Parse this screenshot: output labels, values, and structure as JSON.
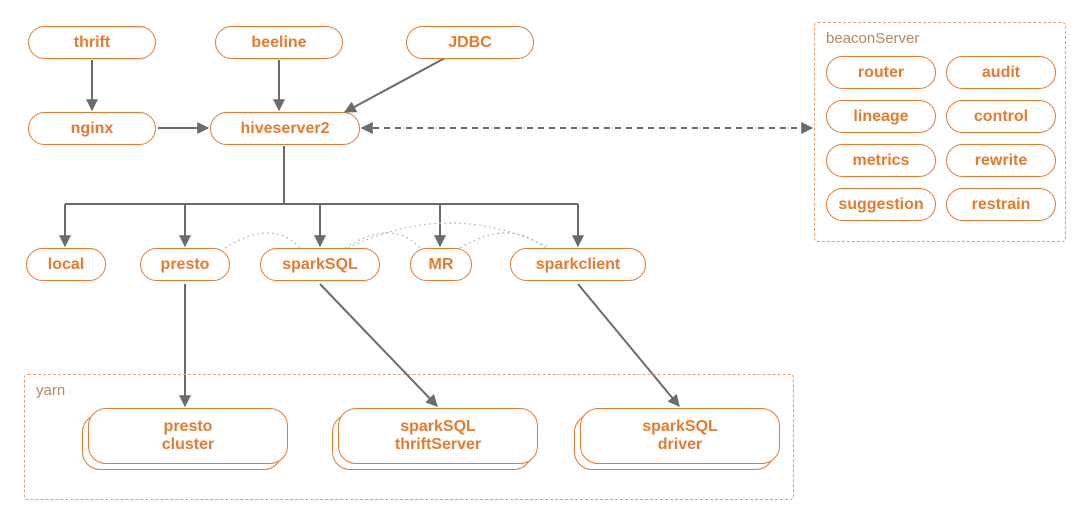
{
  "nodes": {
    "thrift": "thrift",
    "beeline": "beeline",
    "jdbc": "JDBC",
    "nginx": "nginx",
    "hiveserver2": "hiveserver2",
    "local": "local",
    "presto": "presto",
    "sparksql": "sparkSQL",
    "mr": "MR",
    "sparkclient": "sparkclient",
    "presto_cluster": "presto\ncluster",
    "sparksql_thrift": "sparkSQL\nthriftServer",
    "sparksql_driver": "sparkSQL\ndriver"
  },
  "groups": {
    "yarn": "yarn",
    "beacon": "beaconServer"
  },
  "beacon_items": {
    "router": "router",
    "audit": "audit",
    "lineage": "lineage",
    "control": "control",
    "metrics": "metrics",
    "rewrite": "rewrite",
    "suggestion": "suggestion",
    "restrain": "restrain"
  },
  "colors": {
    "primary": "#e47b2f",
    "connector": "#6b6b6b",
    "group_border": "#e4a06b",
    "group_text": "#b4895e"
  }
}
